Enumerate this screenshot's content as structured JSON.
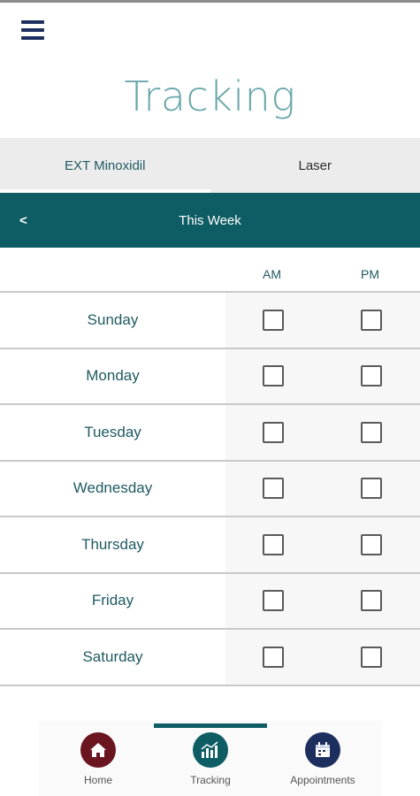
{
  "header": {
    "title": "Tracking"
  },
  "tabs": [
    {
      "label": "EXT  Minoxidil",
      "active": true
    },
    {
      "label": "Laser",
      "active": false
    }
  ],
  "week": {
    "prev_label": "<",
    "label": "This Week"
  },
  "columns": {
    "am": "AM",
    "pm": "PM"
  },
  "days": [
    {
      "name": "Sunday",
      "am": false,
      "pm": false
    },
    {
      "name": "Monday",
      "am": false,
      "pm": false
    },
    {
      "name": "Tuesday",
      "am": false,
      "pm": false
    },
    {
      "name": "Wednesday",
      "am": false,
      "pm": false
    },
    {
      "name": "Thursday",
      "am": false,
      "pm": false
    },
    {
      "name": "Friday",
      "am": false,
      "pm": false
    },
    {
      "name": "Saturday",
      "am": false,
      "pm": false
    }
  ],
  "nav": {
    "items": [
      {
        "label": "Home",
        "icon": "home-icon"
      },
      {
        "label": "Tracking",
        "icon": "chart-icon",
        "active": true
      },
      {
        "label": "Appointments",
        "icon": "calendar-icon"
      }
    ]
  },
  "colors": {
    "primary": "#0e5d64",
    "title": "#6aa7ab",
    "home": "#6b1520",
    "appointments": "#1c2f5e"
  }
}
